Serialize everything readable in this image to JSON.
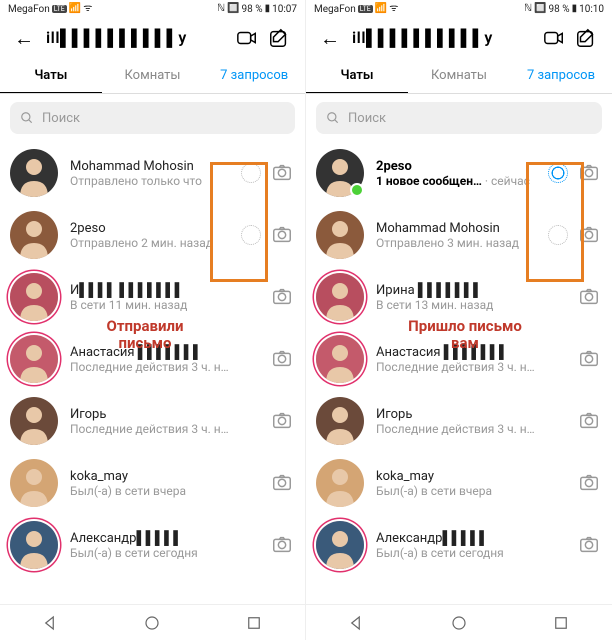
{
  "left": {
    "status": {
      "carrier": "MegaFon",
      "battery": "98 %",
      "time": "10:07"
    },
    "header": {
      "username": "ill▌▌▌▌▌▌▌▌▌▌y"
    },
    "tabs": {
      "chats": "Чаты",
      "rooms": "Комнаты",
      "requests": "7 запросов"
    },
    "search": {
      "placeholder": "Поиск"
    },
    "chats": [
      {
        "name": "Mohammad Mohosin",
        "sub": "Отправлено только что",
        "dot": "sent",
        "camera": true,
        "story": false
      },
      {
        "name": "2peso",
        "sub": "Отправлено 2 мин. назад",
        "dot": "sent",
        "camera": true,
        "story": false
      },
      {
        "name": "И▌▌▌▌ ▌▌▌▌▌▌▌",
        "sub": "В сети 11 мин. назад",
        "dot": null,
        "camera": true,
        "story": true
      },
      {
        "name": "Анастасия ▌▌▌▌▌▌▌",
        "sub": "Последние действия 3 ч. н…",
        "dot": null,
        "camera": true,
        "story": true
      },
      {
        "name": "Игорь",
        "sub": "Последние действия 3 ч. н…",
        "dot": null,
        "camera": true,
        "story": false
      },
      {
        "name": "koka_may",
        "sub": "Был(-а) в сети вчера",
        "dot": null,
        "camera": true,
        "story": false
      },
      {
        "name": "Александр▌▌▌▌▌",
        "sub": "Был(-а) в сети сегодня",
        "dot": null,
        "camera": true,
        "story": true
      }
    ],
    "annotation": "Отправили\nписьмо"
  },
  "right": {
    "status": {
      "carrier": "MegaFon",
      "battery": "98 %",
      "time": "10:10"
    },
    "header": {
      "username": "ill▌▌▌▌▌▌▌▌▌▌y"
    },
    "tabs": {
      "chats": "Чаты",
      "rooms": "Комнаты",
      "requests": "7 запросов"
    },
    "search": {
      "placeholder": "Поиск"
    },
    "chats": [
      {
        "name": "2peso",
        "nameBold": true,
        "sub": "1 новое сообщен…",
        "subBold": true,
        "time": "сейчас",
        "dot": "new",
        "camera": true,
        "story": false,
        "online": true
      },
      {
        "name": "Mohammad Mohosin",
        "sub": "Отправлено 3 мин. назад",
        "dot": "sent",
        "camera": true,
        "story": false
      },
      {
        "name": "Ирина ▌▌▌▌▌▌▌",
        "sub": "В сети 13 мин. назад",
        "dot": null,
        "camera": true,
        "story": true
      },
      {
        "name": "Анастасия ▌▌▌▌▌▌▌",
        "sub": "Последние действия 3 ч. н…",
        "dot": null,
        "camera": true,
        "story": true
      },
      {
        "name": "Игорь",
        "sub": "Последние действия 3 ч. н…",
        "dot": null,
        "camera": true,
        "story": false
      },
      {
        "name": "koka_may",
        "sub": "Был(-а) в сети вчера",
        "dot": null,
        "camera": true,
        "story": false
      },
      {
        "name": "Александр▌▌▌▌▌",
        "sub": "Был(-а) в сети сегодня",
        "dot": null,
        "camera": true,
        "story": true
      }
    ],
    "annotation": "Пришло письмо\nвам"
  }
}
